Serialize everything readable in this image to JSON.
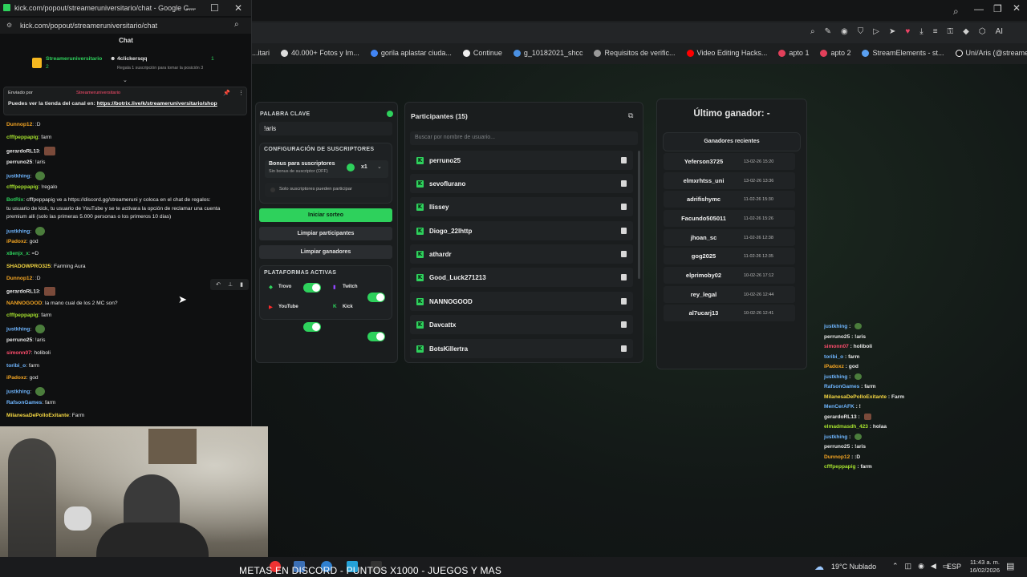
{
  "browser": {
    "bookmarks": [
      "...itari",
      "40.000+ Fotos y Im...",
      "gorila aplastar ciuda...",
      "Continue",
      "g_10182021_shcc",
      "Requisitos de verific...",
      "Video Editing Hacks...",
      "apto 1",
      "apto 2",
      "StreamElements - st...",
      "Uni/Aris (@streame..."
    ]
  },
  "popup": {
    "window_title": "kick.com/popout/streameruniversitario/chat - Google C...",
    "url": "kick.com/popout/streameruniversitario/chat",
    "chat_header": "Chat",
    "leaderboard": {
      "rank1_name": "Streameruniversitario",
      "rank1_count": "2",
      "rank2_name": "4clickersqq",
      "rank2_count": "1",
      "hint": "Regala 1 suscripción para tomar la posición 3"
    },
    "pinned": {
      "label": "Enviado por",
      "sender": "Streameruniversitario",
      "text": "Puedes ver la tienda del canal en:",
      "link": "https://botrix.live/k/streameruniversitario/shop"
    },
    "messages": [
      {
        "user": "Dunnop12",
        "color": "#f5a623",
        "text": ":D"
      },
      {
        "user": "cfffpeppapig",
        "color": "#a6e22e",
        "text": "farm"
      },
      {
        "user": "gerardoRL13",
        "color": "#e8e8e8",
        "text": ""
      },
      {
        "user": "perruno25",
        "color": "#e8e8e8",
        "text": "!aris"
      },
      {
        "user": "justkhing",
        "color": "#6fb6ff",
        "text": ""
      },
      {
        "user": "cfffpeppapig",
        "color": "#a6e22e",
        "text": "!regalo"
      },
      {
        "user": "BotRix",
        "color": "#2ed15c",
        "text": "cfffpeppapig ve a https://discord.gg/streameruni y coloca en el chat de regalos:"
      },
      {
        "user": "",
        "color": "#e8e8e8",
        "text": "tu usuario de kick, tu usuario de YouTube y se te activara la opción de reclamar una cuenta"
      },
      {
        "user": "",
        "color": "#e8e8e8",
        "text": "premium alli (solo las primeras 5.000 personas o los primeros 10 dias)"
      },
      {
        "user": "justkhing",
        "color": "#6fb6ff",
        "text": ""
      },
      {
        "user": "iPadoxz",
        "color": "#f5a623",
        "text": "god"
      },
      {
        "user": "x8enjx_x",
        "color": "#2ed15c",
        "text": "=D"
      },
      {
        "user": "SHADOWPRO325",
        "color": "#f5d742",
        "text": "Farming Aura"
      },
      {
        "user": "Dunnop12",
        "color": "#f5a623",
        "text": ":D"
      },
      {
        "user": "gerardoRL13",
        "color": "#e8e8e8",
        "text": ""
      },
      {
        "user": "NANNOGOOD",
        "color": "#f5a623",
        "text": "la mano cual de los 2 MC son?"
      },
      {
        "user": "cfffpeppapig",
        "color": "#a6e22e",
        "text": "farm"
      },
      {
        "user": "justkhing",
        "color": "#6fb6ff",
        "text": ""
      },
      {
        "user": "perruno25",
        "color": "#e8e8e8",
        "text": "!aris"
      },
      {
        "user": "simonn07",
        "color": "#ff4d6d",
        "text": "holiboli"
      },
      {
        "user": "toribi_o",
        "color": "#6fb6ff",
        "text": "farm"
      },
      {
        "user": "iPadoxz",
        "color": "#f5a623",
        "text": "god"
      },
      {
        "user": "justkhing",
        "color": "#6fb6ff",
        "text": ""
      },
      {
        "user": "RafsonGames",
        "color": "#6fb6ff",
        "text": "farm"
      },
      {
        "user": "MilanesaDePolloExitante",
        "color": "#f5d742",
        "text": "Farm"
      }
    ]
  },
  "giveaway": {
    "keyword_label": "PALABRA CLAVE",
    "keyword_value": "!aris",
    "subs_config_label": "CONFIGURACIÓN DE SUSCRIPTORES",
    "bonus_title": "Bonus para suscriptores",
    "bonus_sub": "Sin bonus de suscriptor (OFF)",
    "multiplier": "x1",
    "subs_only": "Solo suscriptores pueden participar",
    "start_button": "Iniciar sorteo",
    "clear_participants": "Limpiar participantes",
    "clear_winners": "Limpiar ganadores",
    "platforms_label": "PLATAFORMAS ACTIVAS",
    "platforms": [
      "Trovo",
      "Twitch",
      "YouTube",
      "Kick"
    ],
    "participants_title": "Participantes (15)",
    "search_placeholder": "Buscar por nombre de usuario...",
    "participants": [
      "perruno25",
      "sevoflurano",
      "llissey",
      "Diogo_22lhttp",
      "athardr",
      "Good_Luck271213",
      "NANNOGOOD",
      "Davcattx",
      "BotsKillertra"
    ],
    "last_winner": "Último ganador: -",
    "recent_title": "Ganadores recientes",
    "recent": [
      {
        "name": "Yeferson3725",
        "date": "13-02-26 15:20"
      },
      {
        "name": "elmxrhtss_uni",
        "date": "13-02-26 13:36"
      },
      {
        "name": "adrifishymc",
        "date": "11-02-26 15:30"
      },
      {
        "name": "Facundo505011",
        "date": "11-02-26 15:26"
      },
      {
        "name": "jhoan_sc",
        "date": "11-02-26 12:38"
      },
      {
        "name": "gog2025",
        "date": "11-02-26 12:35"
      },
      {
        "name": "elprimoby02",
        "date": "10-02-26 17:12"
      },
      {
        "name": "rey_legal",
        "date": "10-02-26 12:44"
      },
      {
        "name": "al7ucarj13",
        "date": "10-02-26 12:41"
      }
    ]
  },
  "overlay_chat": [
    {
      "user": "justkhing",
      "color": "#6fb6ff",
      "text": ""
    },
    {
      "user": "perruno25",
      "color": "#e8e8e8",
      "text": "!aris"
    },
    {
      "user": "simonn07",
      "color": "#ff4d6d",
      "text": "holiboli"
    },
    {
      "user": "toribi_o",
      "color": "#6fb6ff",
      "text": "farm"
    },
    {
      "user": "iPadoxz",
      "color": "#f5a623",
      "text": "god"
    },
    {
      "user": "justkhing",
      "color": "#6fb6ff",
      "text": ""
    },
    {
      "user": "RafsonGames",
      "color": "#6fb6ff",
      "text": "farm"
    },
    {
      "user": "MilanesaDePolloExitante",
      "color": "#f5d742",
      "text": "Farm"
    },
    {
      "user": "MenCerAFK",
      "color": "#6fb6ff",
      "text": "!"
    },
    {
      "user": "gerardoRL13",
      "color": "#e8e8e8",
      "text": ""
    },
    {
      "user": "elmadmasdh_423",
      "color": "#a6e22e",
      "text": "holaa"
    },
    {
      "user": "justkhing",
      "color": "#6fb6ff",
      "text": ""
    },
    {
      "user": "perruno25",
      "color": "#e8e8e8",
      "text": "!aris"
    },
    {
      "user": "Dunnop12",
      "color": "#f5a623",
      "text": ":D"
    },
    {
      "user": "cfffpeppapig",
      "color": "#a6e22e",
      "text": "farm"
    }
  ],
  "stream": {
    "marquee": "METAS EN DISCORD - PUNTOS X1000 - JUEGOS Y MAS"
  },
  "taskbar": {
    "weather": "19°C Nublado",
    "lang": "ESP",
    "time": "11:43 a. m.",
    "date": "16/02/2026"
  }
}
